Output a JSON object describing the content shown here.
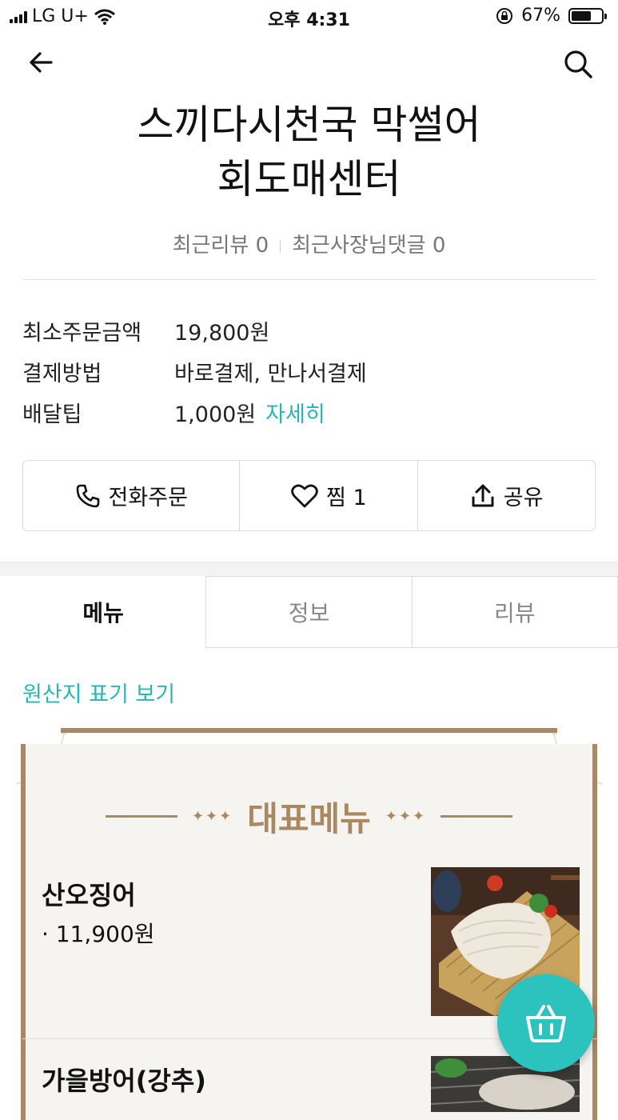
{
  "status_bar": {
    "carrier": "LG U+",
    "time": "오후 4:31",
    "battery": "67%",
    "battery_level": 0.67
  },
  "store": {
    "name_line1": "스끼다시천국 막썰어",
    "name_line2": "회도매센터",
    "recent_reviews": "최근리뷰 0",
    "owner_replies": "최근사장님댓글 0"
  },
  "info": {
    "min_order_label": "최소주문금액",
    "min_order_value": "19,800원",
    "payment_label": "결제방법",
    "payment_value": "바로결제, 만나서결제",
    "tip_label": "배달팁",
    "tip_value": "1,000원",
    "tip_detail": "자세히"
  },
  "actions": {
    "call": "전화주문",
    "like": "찜 1",
    "share": "공유"
  },
  "tabs": [
    "메뉴",
    "정보",
    "리뷰"
  ],
  "origin_link": "원산지 표기 보기",
  "board": {
    "title": "대표메뉴",
    "dots": "✦✦✦"
  },
  "menu_items": [
    {
      "name": "산오징어",
      "price": "· 11,900원"
    },
    {
      "name": "가을방어(강추)",
      "price": ""
    }
  ],
  "colors": {
    "accent": "#2ab5b5",
    "fab": "#2cc2bd",
    "board": "#a98862"
  }
}
